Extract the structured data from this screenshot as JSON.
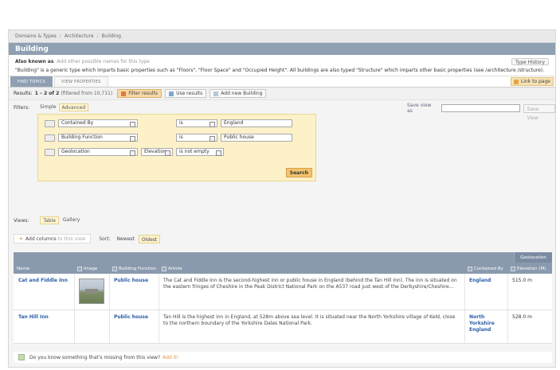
{
  "breadcrumb": [
    "Domains & Types",
    "Architecture",
    "Building"
  ],
  "title": "Building",
  "also_known": {
    "label": "Also known as",
    "hint": "Add other possible names for this type"
  },
  "type_history": "Type History",
  "description": "\"Building\" is a generic type which imparts basic properties such as \"Floors\", \"Floor Space\" and \"Occupied Height\".  All buildings are also typed \"Structure\" which imparts other basic properties (see /architecture /structure).",
  "tabs": [
    "FIND TOPICS",
    "VIEW PROPERTIES"
  ],
  "link_to_page": "Link to page",
  "results": {
    "label": "Results:",
    "range": "1 – 2 of 2",
    "filtered": "(filtered from 10,711)"
  },
  "buttons": {
    "filter": "Filter results",
    "use": "Use results",
    "add": "Add new Building"
  },
  "filters": {
    "label": "Filters:",
    "modes": [
      "Simple",
      "Advanced"
    ],
    "rows": [
      {
        "prop": "Contained By",
        "op": "is",
        "value": "England"
      },
      {
        "prop": "Building Function",
        "op": "is",
        "value": "Public house"
      },
      {
        "prop": "Geolocation",
        "sub": "Elevation",
        "op": "is not empty"
      }
    ],
    "search": "Search"
  },
  "save_view": {
    "label": "Save view as",
    "button": "Save View"
  },
  "views": {
    "label": "Views:",
    "options": [
      "Table",
      "Gallery"
    ]
  },
  "sort": {
    "add_columns": "Add columns",
    "add_columns_hint": "to this view",
    "label": "Sort:",
    "options": [
      "Newest",
      "Oldest"
    ]
  },
  "table": {
    "group_header": "Geolocation",
    "columns": [
      "Name",
      "Image",
      "Building Function",
      "Article",
      "Contained By",
      "Elevation (M)"
    ],
    "rows": [
      {
        "name": "Cat and Fiddle Inn",
        "function": "Public house",
        "article": "The Cat and Fiddle Inn is the second-highest inn or public house in England (behind the Tan Hill Inn). The inn is situated on the eastern fringes of Cheshire in the Peak District National Park on the A537 road just west of the Derbyshire/Cheshire...",
        "contained": [
          "England"
        ],
        "elevation": "515.0 m"
      },
      {
        "name": "Tan Hill Inn",
        "function": "Public house",
        "article": "Tan Hill is the highest inn in England, at 528m above sea level. It is situated near the North Yorkshire village of Keld, close to the northern boundary of the Yorkshire Dales National Park.",
        "contained": [
          "North Yorkshire",
          "England"
        ],
        "elevation": "528.0 m"
      }
    ]
  },
  "missing": {
    "text": "Do you know something that's missing from this view?",
    "link": "Add it!"
  }
}
